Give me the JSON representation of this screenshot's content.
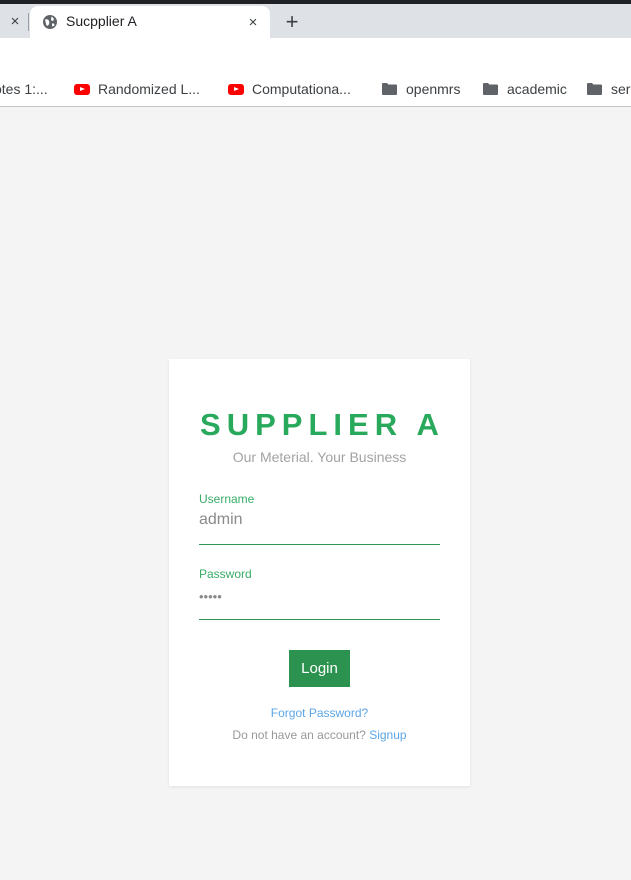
{
  "browser": {
    "tab_title": "Sucpplier A",
    "new_tab_symbol": "+",
    "close_symbol": "×",
    "bookmarks": [
      {
        "label": "otes 1:...",
        "icon": "none"
      },
      {
        "label": "Randomized L...",
        "icon": "youtube-icon"
      },
      {
        "label": "Computationa...",
        "icon": "youtube-icon"
      },
      {
        "label": "openmrs",
        "icon": "folder-icon"
      },
      {
        "label": "academic",
        "icon": "folder-icon"
      },
      {
        "label": "ser",
        "icon": "folder-icon"
      }
    ]
  },
  "login": {
    "brand": "SUPPLIER A",
    "tagline": "Our Meterial. Your Business",
    "username_label": "Username",
    "username_value": "admin",
    "password_label": "Password",
    "password_value": "•••••",
    "login_button": "Login",
    "forgot_password": "Forgot Password?",
    "no_account_text": "Do not have an account?",
    "signup_link": "Signup"
  },
  "colors": {
    "brand_green": "#28a95b",
    "button_green": "#2b924f",
    "link_blue": "#5aa5e6",
    "page_background": "#f4f4f4"
  }
}
